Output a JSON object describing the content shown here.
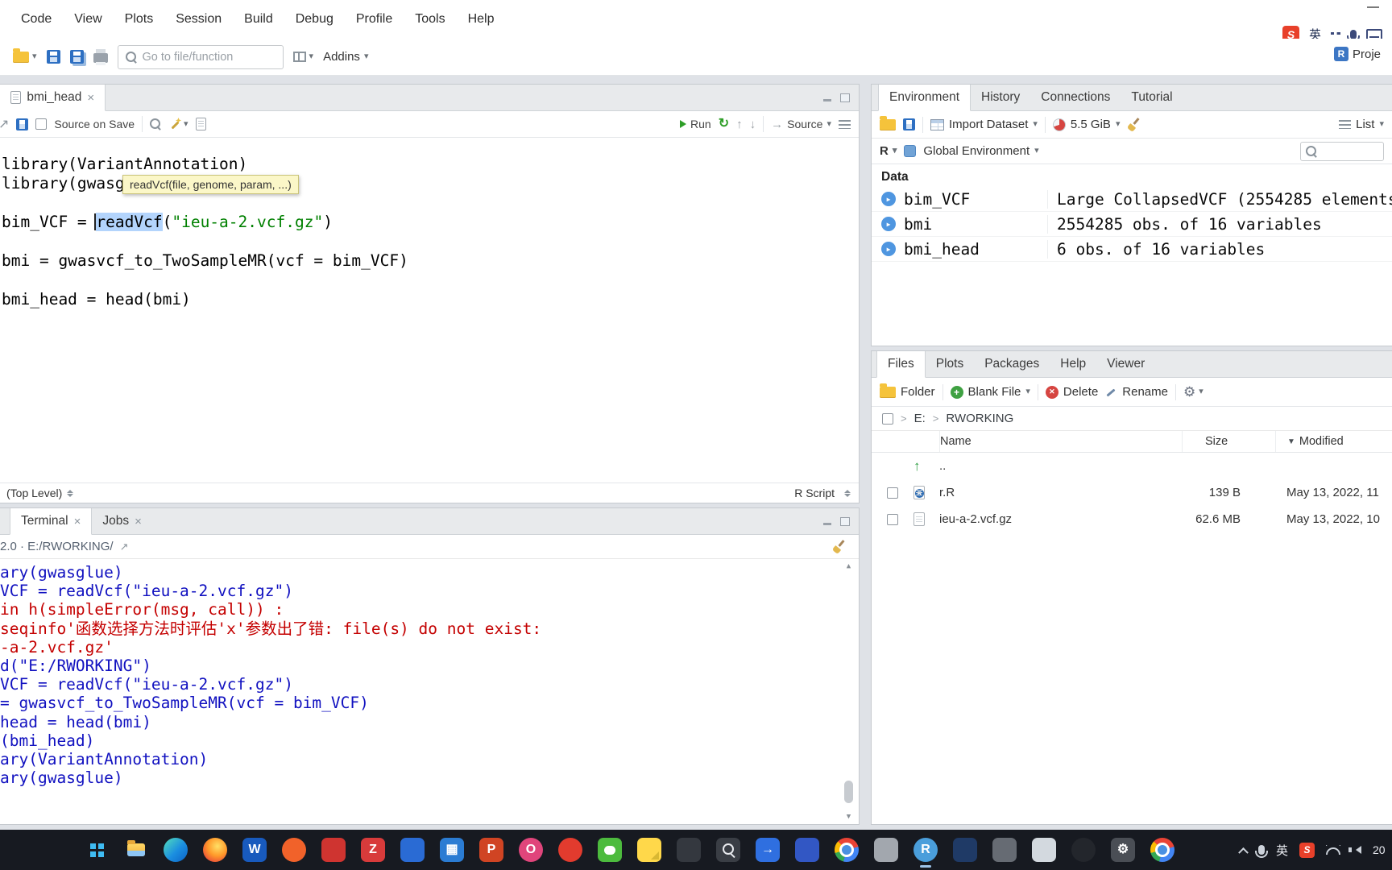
{
  "colors": {
    "selection": "#b3d4fc",
    "tooltip_bg": "#fbf7c8",
    "console_cmd": "#1111c0",
    "console_err": "#c40000",
    "run_green": "#2e9e27",
    "string_green": "#008000"
  },
  "glyphs": {
    "caret_down": "▾",
    "sort_desc": "▼",
    "close": "×",
    "rerun": "↻",
    "arrow_up": "↑",
    "arrow_down": "↓",
    "external": "↗",
    "gear": "⚙",
    "expand_play": "▶",
    "updir_arrow": "↑",
    "crumb_sep": ">",
    "plus": "+",
    "cross": "✕",
    "tri_up": "▲",
    "tri_down": "▼",
    "chevron_left": "‹",
    "r_logo": "R",
    "arrow_right": "→"
  },
  "menu": {
    "items": [
      "Code",
      "View",
      "Plots",
      "Session",
      "Build",
      "Debug",
      "Profile",
      "Tools",
      "Help"
    ]
  },
  "toolbar": {
    "goto_placeholder": "Go to file/function",
    "addins": "Addins",
    "project": "Proje"
  },
  "ime": {
    "badge": "S",
    "lang": "英"
  },
  "editor": {
    "tab": "bmi_head",
    "source_on_save": "Source on Save",
    "run": "Run",
    "source_btn": "Source",
    "tooltip": "readVcf(file, genome, param, ...)",
    "l1": "library(VariantAnnotation)",
    "l2": "library(gwasg",
    "l4a": "bim_VCF = ",
    "l4b": "readVcf",
    "l4c": "(",
    "l4d": "\"ieu-a-2.vcf.gz\"",
    "l4e": ")",
    "l6": "bmi = gwasvcf_to_TwoSampleMR(vcf = bim_VCF)",
    "l8": "bmi_head = head(bmi)",
    "scope": "(Top Level)",
    "doc_type": "R Script"
  },
  "terminal": {
    "tab_terminal": "Terminal",
    "tab_jobs": "Jobs",
    "header": "2.0 · E:/RWORKING/",
    "lines": [
      {
        "text": "ary(gwasglue)",
        "kind": "cmd"
      },
      {
        "text": "VCF = readVcf(\"ieu-a-2.vcf.gz\")",
        "kind": "cmd"
      },
      {
        "text": "in h(simpleError(msg, call)) :",
        "kind": "err"
      },
      {
        "text": "seqinfo'函数选择方法时评估'x'参数出了错: file(s) do not exist:",
        "kind": "err"
      },
      {
        "text": "-a-2.vcf.gz'",
        "kind": "err"
      },
      {
        "text": "d(\"E:/RWORKING\")",
        "kind": "cmd"
      },
      {
        "text": "VCF = readVcf(\"ieu-a-2.vcf.gz\")",
        "kind": "cmd"
      },
      {
        "text": "= gwasvcf_to_TwoSampleMR(vcf = bim_VCF)",
        "kind": "cmd"
      },
      {
        "text": "head = head(bmi)",
        "kind": "cmd"
      },
      {
        "text": "(bmi_head)",
        "kind": "cmd"
      },
      {
        "text": "ary(VariantAnnotation)",
        "kind": "cmd"
      },
      {
        "text": "ary(gwasglue)",
        "kind": "cmd"
      }
    ]
  },
  "environment": {
    "tabs": [
      "Environment",
      "History",
      "Connections",
      "Tutorial"
    ],
    "import_label": "Import Dataset",
    "memory": "5.5 GiB",
    "list_label": "List",
    "lang": "R",
    "scope": "Global Environment",
    "section": "Data",
    "rows": [
      {
        "name": "bim_VCF",
        "value": "Large CollapsedVCF (2554285 elements"
      },
      {
        "name": "bmi",
        "value": "2554285 obs. of 16 variables"
      },
      {
        "name": "bmi_head",
        "value": "6 obs. of 16 variables"
      }
    ]
  },
  "files": {
    "tabs": [
      "Files",
      "Plots",
      "Packages",
      "Help",
      "Viewer"
    ],
    "new_folder": "Folder",
    "blank_file": "Blank File",
    "delete_label": "Delete",
    "rename_label": "Rename",
    "crumbs": [
      "E:",
      "RWORKING"
    ],
    "col_name": "Name",
    "col_size": "Size",
    "col_modified": "Modified",
    "updir": "..",
    "rows": [
      {
        "name": "r.R",
        "size": "139 B",
        "modified": "May 13, 2022, 11"
      },
      {
        "name": "ieu-a-2.vcf.gz",
        "size": "62.6 MB",
        "modified": "May 13, 2022, 10"
      }
    ]
  },
  "taskbar": {
    "lang": "英",
    "badge": "S",
    "clock": "20",
    "apps": [
      {
        "name": "start",
        "glyph": "",
        "bg": ""
      },
      {
        "name": "file-explorer",
        "glyph": "",
        "bg": ""
      },
      {
        "name": "edge",
        "glyph": "",
        "bg": ""
      },
      {
        "name": "firefox",
        "glyph": "",
        "bg": ""
      },
      {
        "name": "word",
        "glyph": "W",
        "bg": "#185abd"
      },
      {
        "name": "app-orange",
        "glyph": "",
        "bg": "#f1622a"
      },
      {
        "name": "app-red",
        "glyph": "",
        "bg": "#cf3430"
      },
      {
        "name": "app-z",
        "glyph": "Z",
        "bg": "#d83b3b"
      },
      {
        "name": "app-blue",
        "glyph": "",
        "bg": "#2a6bd4"
      },
      {
        "name": "app-grid",
        "glyph": "▦",
        "bg": "#2b7cd3"
      },
      {
        "name": "powerpoint",
        "glyph": "P",
        "bg": "#d04423"
      },
      {
        "name": "app-o",
        "glyph": "O",
        "bg": "#e0457b"
      },
      {
        "name": "app-red-circle",
        "glyph": "",
        "bg": "#e23b2e"
      },
      {
        "name": "wechat",
        "glyph": "",
        "bg": "#4dbb3e"
      },
      {
        "name": "sticky-notes",
        "glyph": "",
        "bg": "#ffd84a"
      },
      {
        "name": "app-dark",
        "glyph": "",
        "bg": "#34383f"
      },
      {
        "name": "search",
        "glyph": "",
        "bg": "#3a3e45"
      },
      {
        "name": "app-arrow",
        "glyph": "→",
        "bg": "#2f6fe0"
      },
      {
        "name": "app-blue2",
        "glyph": "",
        "bg": "#3257c4"
      },
      {
        "name": "chrome",
        "glyph": "",
        "bg": ""
      },
      {
        "name": "app-gray",
        "glyph": "",
        "bg": "#a2a7ae"
      },
      {
        "name": "rstudio",
        "glyph": "R",
        "bg": "#4a9edb"
      },
      {
        "name": "app-navy",
        "glyph": "",
        "bg": "#1f3a66"
      },
      {
        "name": "app-gray2",
        "glyph": "",
        "bg": "#666b73"
      },
      {
        "name": "app-light",
        "glyph": "",
        "bg": "#d3d9df"
      },
      {
        "name": "github",
        "glyph": "",
        "bg": "#23262c"
      },
      {
        "name": "settings",
        "glyph": "⚙",
        "bg": "#4a4e55"
      },
      {
        "name": "browser",
        "glyph": "",
        "bg": ""
      }
    ]
  }
}
